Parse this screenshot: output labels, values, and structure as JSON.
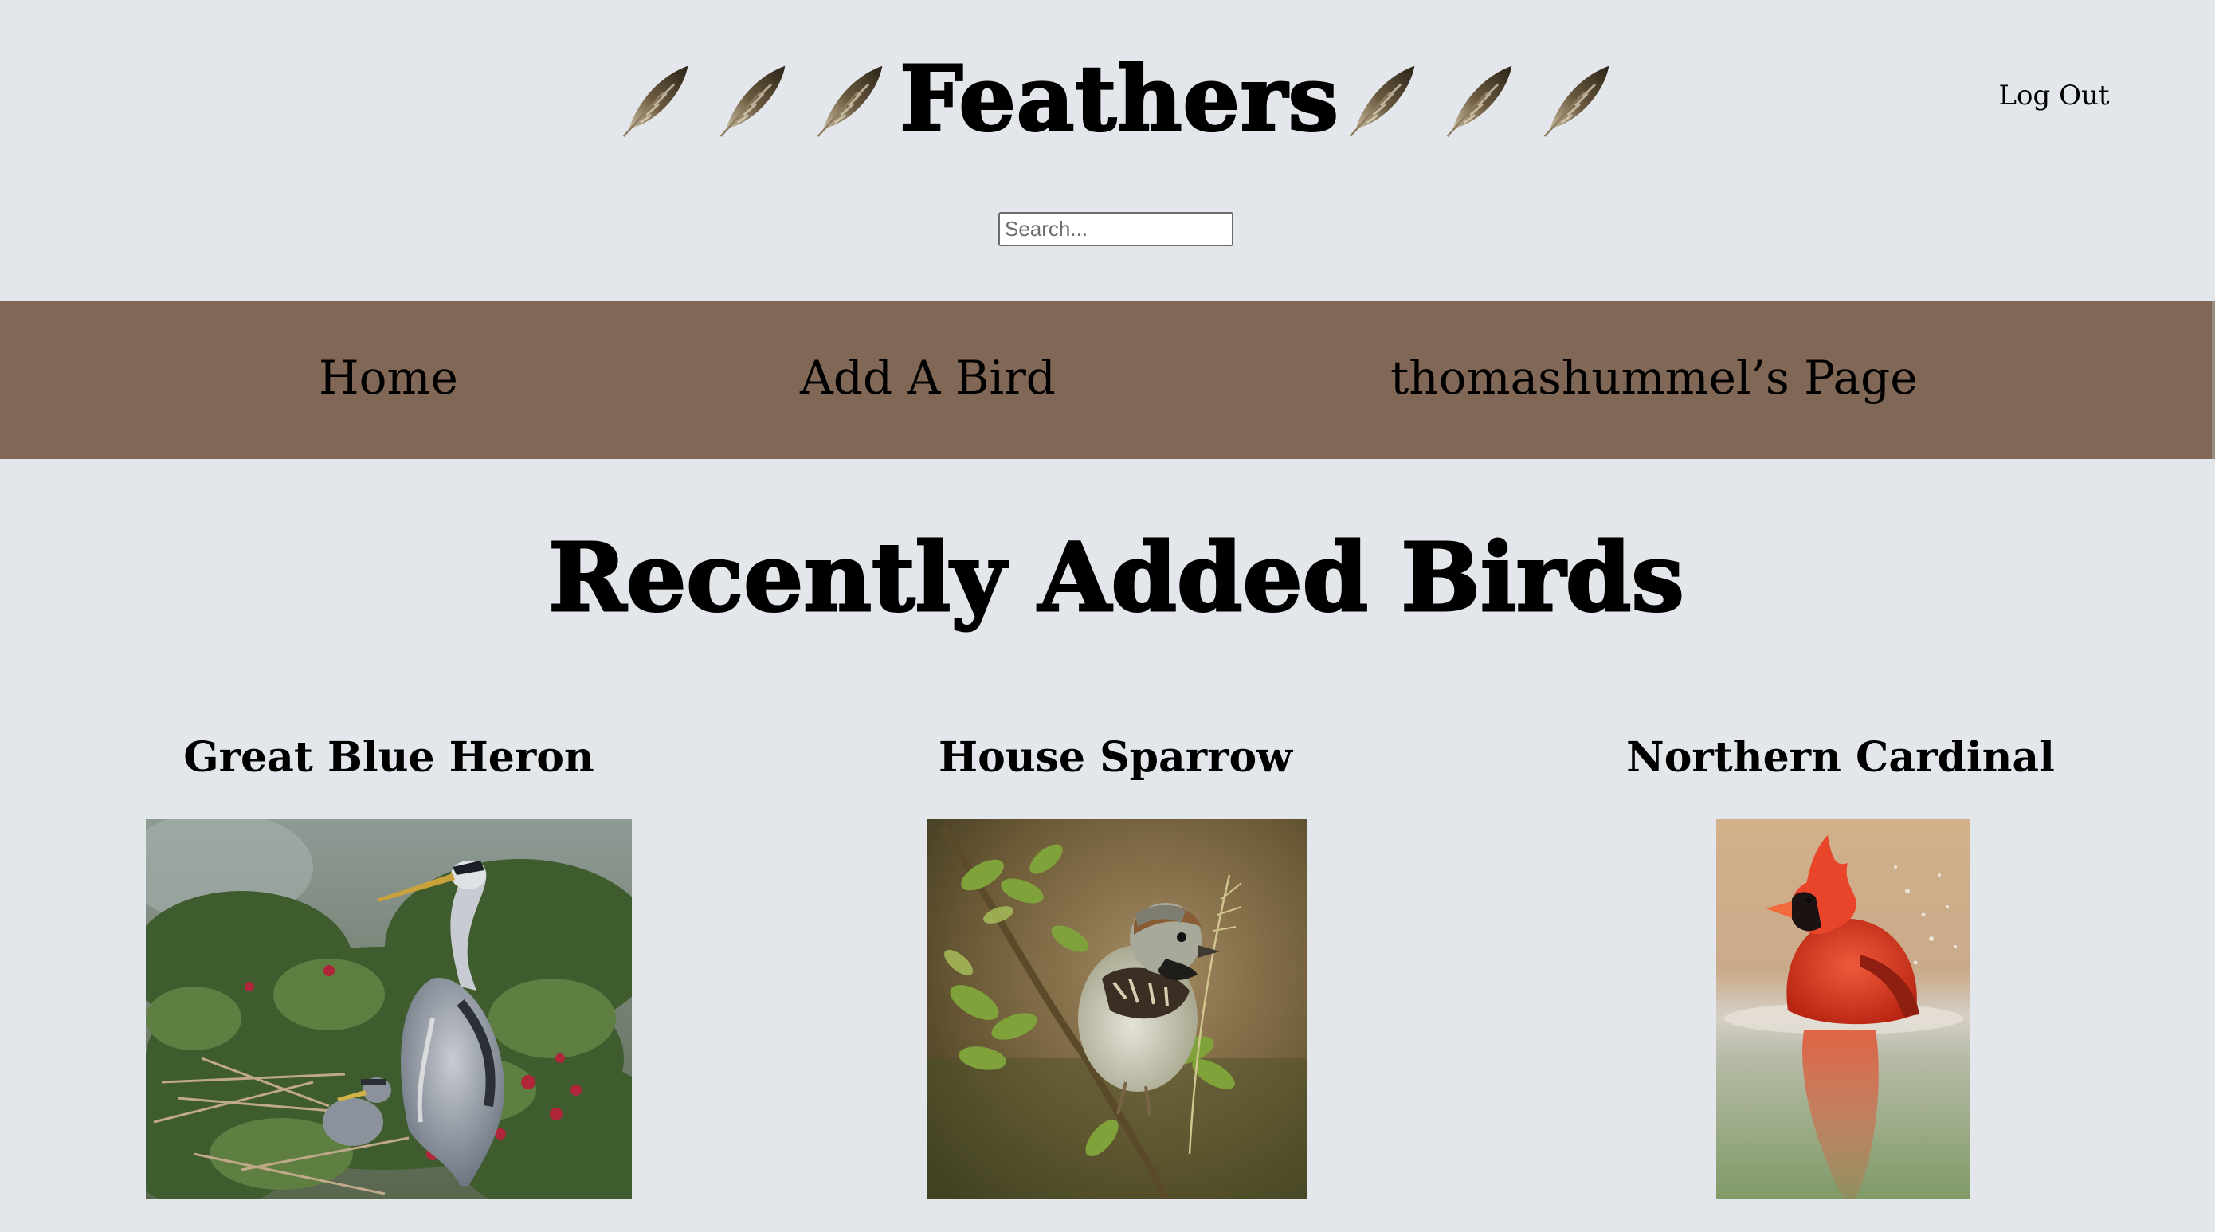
{
  "header": {
    "site_title": "Feathers",
    "logout_label": "Log Out",
    "search": {
      "placeholder": "Search..."
    },
    "feather_icons": [
      "feather-icon",
      "feather-icon",
      "feather-icon",
      "feather-icon",
      "feather-icon",
      "feather-icon"
    ]
  },
  "nav": {
    "items": [
      {
        "label": "Home"
      },
      {
        "label": "Add A Bird"
      },
      {
        "label": "thomashummel’s Page"
      }
    ]
  },
  "main": {
    "section_title": "Recently Added Birds",
    "birds": [
      {
        "name": "Great Blue Heron"
      },
      {
        "name": "House Sparrow"
      },
      {
        "name": "Northern Cardinal"
      }
    ]
  },
  "colors": {
    "page_background": "#e3e6eb",
    "nav_background": "#816756",
    "text": "#000000"
  }
}
